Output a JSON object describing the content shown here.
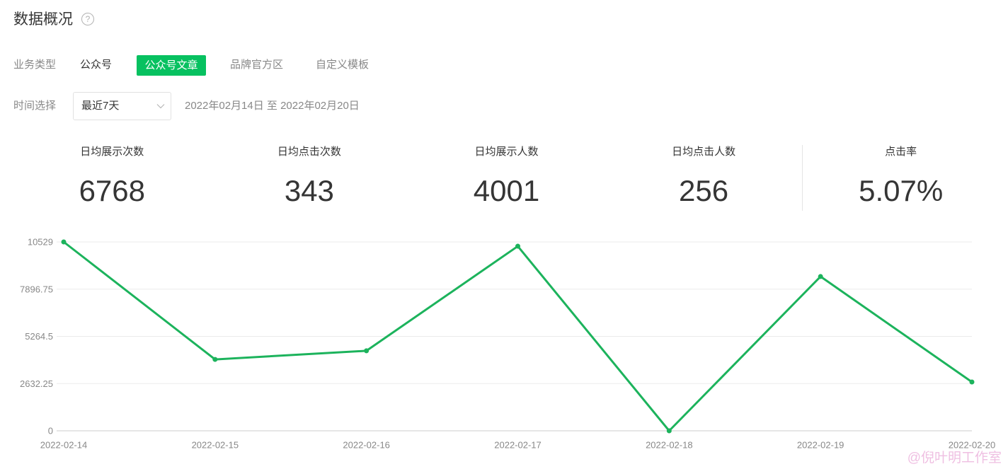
{
  "page": {
    "title": "数据概况",
    "help_icon": "question-circle-icon"
  },
  "filters": {
    "business_type": {
      "label": "业务类型",
      "options": [
        {
          "label": "公众号",
          "selected": false
        },
        {
          "label": "公众号文章",
          "selected": true
        },
        {
          "label": "品牌官方区",
          "selected": false
        },
        {
          "label": "自定义模板",
          "selected": false
        }
      ]
    },
    "time": {
      "label": "时间选择",
      "selected": "最近7天",
      "dropdown_icon": "chevron-down-icon",
      "range_text": "2022年02月14日 至 2022年02月20日"
    }
  },
  "stats": [
    {
      "label": "日均展示次数",
      "value": "6768"
    },
    {
      "label": "日均点击次数",
      "value": "343"
    },
    {
      "label": "日均展示人数",
      "value": "4001"
    },
    {
      "label": "日均点击人数",
      "value": "256"
    },
    {
      "label": "点击率",
      "value": "5.07%"
    }
  ],
  "chart_data": {
    "type": "line",
    "categories": [
      "2022-02-14",
      "2022-02-15",
      "2022-02-16",
      "2022-02-17",
      "2022-02-18",
      "2022-02-19",
      "2022-02-20"
    ],
    "series": [
      {
        "values": [
          10529,
          3980,
          4460,
          10290,
          0,
          8600,
          2720
        ]
      }
    ],
    "y_ticks": [
      "0",
      "2632.25",
      "5264.5",
      "7896.75",
      "10529"
    ],
    "ylim": [
      0,
      10529
    ],
    "grid": true,
    "markers": true
  },
  "watermark": "@倪叶明工作室",
  "colors": {
    "accent": "#07c160",
    "line": "#1cb35c",
    "text": "#353535",
    "muted_text": "#888888"
  }
}
